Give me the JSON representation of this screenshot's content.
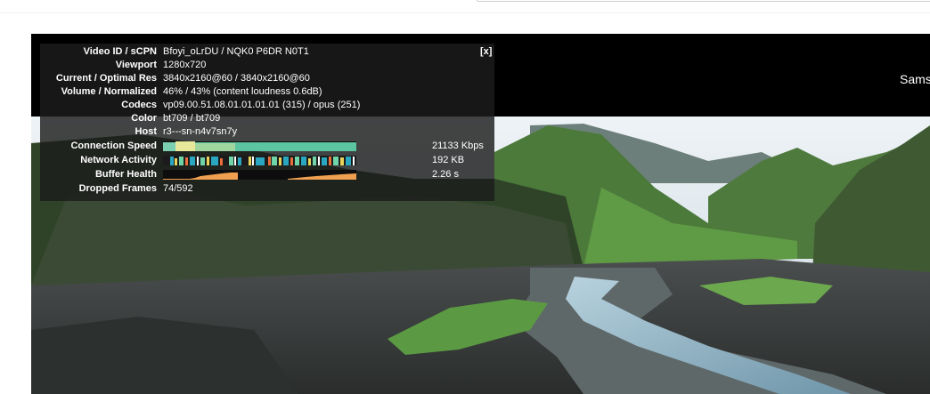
{
  "colors": {
    "panel_bg": "rgba(28,28,28,0.82)",
    "speed_graph": "#5bc4a0",
    "speed_highlight": "#e8e89a",
    "buffer_graph": "#f0a050",
    "network_colors": [
      "#2aa6c0",
      "#e8d45a",
      "#e86f3a",
      "#6fd4a8",
      "#ffffff"
    ]
  },
  "overlay": {
    "close_label": "[x]",
    "partial_title": "Sams"
  },
  "stats": {
    "video_id": {
      "label": "Video ID / sCPN",
      "value": "Bfoyi_oLrDU / NQK0 P6DR N0T1"
    },
    "viewport": {
      "label": "Viewport",
      "value": "1280x720"
    },
    "resolution": {
      "label": "Current / Optimal Res",
      "value": "3840x2160@60 / 3840x2160@60"
    },
    "volume": {
      "label": "Volume / Normalized",
      "value": "46% / 43% (content loudness 0.6dB)"
    },
    "codecs": {
      "label": "Codecs",
      "value": "vp09.00.51.08.01.01.01.01 (315) / opus (251)"
    },
    "color": {
      "label": "Color",
      "value": "bt709 / bt709"
    },
    "host": {
      "label": "Host",
      "value": "r3---sn-n4v7sn7y"
    },
    "connection_speed": {
      "label": "Connection Speed",
      "value": "21133 Kbps"
    },
    "network_activity": {
      "label": "Network Activity",
      "value": "192 KB"
    },
    "buffer_health": {
      "label": "Buffer Health",
      "value": "2.26 s"
    },
    "dropped_frames": {
      "label": "Dropped Frames",
      "value": "74/592"
    }
  }
}
